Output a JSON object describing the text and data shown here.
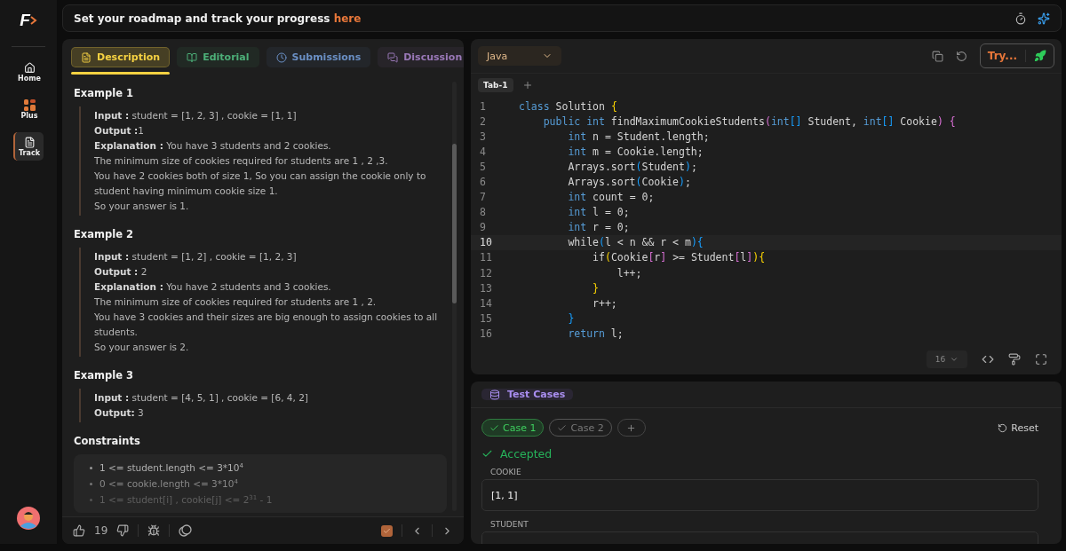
{
  "sidebar": {
    "logo": "F",
    "items": [
      {
        "label": "Home",
        "selected": false
      },
      {
        "label": "Plus",
        "selected": false
      },
      {
        "label": "Track",
        "selected": true
      }
    ]
  },
  "banner": {
    "text": "Set your roadmap and track your progress ",
    "link": "here"
  },
  "description_tabs": [
    {
      "label": "Description",
      "color": "#f5d142",
      "selected": true
    },
    {
      "label": "Editorial",
      "color": "#4caf78",
      "selected": false
    },
    {
      "label": "Submissions",
      "color": "#6a8fc4",
      "selected": false
    },
    {
      "label": "Discussion",
      "color": "#9a78b8",
      "selected": false
    }
  ],
  "examples": [
    {
      "title": "Example 1",
      "lines": [
        "**Input :** student = [1, 2, 3] , cookie = [1, 1]",
        "**Output :**1",
        "**Explanation :** You have 3 students and 2 cookies.",
        "The minimum size of cookies required for students are 1 , 2 ,3.",
        "You have 2 cookies both of size 1, So you can assign the cookie only to student having minimum cookie size 1.",
        "So your answer is 1."
      ]
    },
    {
      "title": "Example 2",
      "lines": [
        "**Input :** student = [1, 2] , cookie = [1, 2, 3]",
        "**Output :** 2",
        "**Explanation :** You have 2 students and 3 cookies.",
        "The minimum size of cookies required for students are 1 , 2.",
        "You have 3 cookies and their sizes are big enough to assign cookies to all students.",
        "So your answer is 2."
      ]
    },
    {
      "title": "Example 3",
      "lines": [
        "**Input :** student = [4, 5, 1] , cookie = [6, 4, 2]",
        "**Output:**  3"
      ]
    }
  ],
  "constraints": {
    "title": "Constraints",
    "items": [
      "1 <= student.length <= 3*10$^{4}$",
      "0 <= cookie.length <= 3*10$^{4}$",
      "1 <= student[i] , cookie[j] <= 2$^{31}$ - 1"
    ]
  },
  "footer": {
    "likes": "19",
    "solved": true
  },
  "editor": {
    "language": "Java",
    "run_label": "Try...",
    "tabs": [
      {
        "label": "Tab-1",
        "selected": true
      }
    ],
    "font_size": "16",
    "lines": [
      {
        "number": "1",
        "selected": false,
        "tokens": [
          {
            "kind": "kw",
            "text": "class"
          },
          {
            "kind": "txt",
            "text": " Solution "
          },
          {
            "kind": "b1",
            "text": "{"
          }
        ]
      },
      {
        "number": "2",
        "selected": false,
        "tokens": [
          {
            "kind": "kw",
            "text": "    public int"
          },
          {
            "kind": "txt",
            "text": " findMaximumCookieStudents"
          },
          {
            "kind": "b2",
            "text": "("
          },
          {
            "kind": "kw",
            "text": "int"
          },
          {
            "kind": "b3",
            "text": "[]"
          },
          {
            "kind": "txt",
            "text": " Student, "
          },
          {
            "kind": "kw",
            "text": "int"
          },
          {
            "kind": "b3",
            "text": "[]"
          },
          {
            "kind": "txt",
            "text": " Cookie"
          },
          {
            "kind": "b2",
            "text": ") {"
          }
        ]
      },
      {
        "number": "3",
        "selected": false,
        "tokens": [
          {
            "kind": "kw",
            "text": "        int"
          },
          {
            "kind": "txt",
            "text": " n = Student.length;"
          }
        ]
      },
      {
        "number": "4",
        "selected": false,
        "tokens": [
          {
            "kind": "kw",
            "text": "        int"
          },
          {
            "kind": "txt",
            "text": " m = Cookie.length;"
          }
        ]
      },
      {
        "number": "5",
        "selected": false,
        "tokens": [
          {
            "kind": "txt",
            "text": "        Arrays.sort"
          },
          {
            "kind": "b3",
            "text": "("
          },
          {
            "kind": "txt",
            "text": "Student"
          },
          {
            "kind": "b3",
            "text": ")"
          },
          {
            "kind": "txt",
            "text": ";"
          }
        ]
      },
      {
        "number": "6",
        "selected": false,
        "tokens": [
          {
            "kind": "txt",
            "text": "        Arrays.sort"
          },
          {
            "kind": "b3",
            "text": "("
          },
          {
            "kind": "txt",
            "text": "Cookie"
          },
          {
            "kind": "b3",
            "text": ")"
          },
          {
            "kind": "txt",
            "text": ";"
          }
        ]
      },
      {
        "number": "7",
        "selected": false,
        "tokens": [
          {
            "kind": "kw",
            "text": "        int"
          },
          {
            "kind": "txt",
            "text": " count = 0;"
          }
        ]
      },
      {
        "number": "8",
        "selected": false,
        "tokens": [
          {
            "kind": "kw",
            "text": "        int"
          },
          {
            "kind": "txt",
            "text": " l = 0;"
          }
        ]
      },
      {
        "number": "9",
        "selected": false,
        "tokens": [
          {
            "kind": "kw",
            "text": "        int"
          },
          {
            "kind": "txt",
            "text": " r = 0;"
          }
        ]
      },
      {
        "number": "10",
        "selected": true,
        "tokens": [
          {
            "kind": "txt",
            "text": "        while"
          },
          {
            "kind": "b3",
            "text": "("
          },
          {
            "kind": "txt",
            "text": "l < n && r < m"
          },
          {
            "kind": "b3",
            "text": ")"
          },
          {
            "kind": "b3",
            "text": "{"
          }
        ]
      },
      {
        "number": "11",
        "selected": false,
        "tokens": [
          {
            "kind": "txt",
            "text": "            if"
          },
          {
            "kind": "b1",
            "text": "("
          },
          {
            "kind": "txt",
            "text": "Cookie"
          },
          {
            "kind": "b2",
            "text": "["
          },
          {
            "kind": "txt",
            "text": "r"
          },
          {
            "kind": "b2",
            "text": "]"
          },
          {
            "kind": "txt",
            "text": " >= Student"
          },
          {
            "kind": "b2",
            "text": "["
          },
          {
            "kind": "txt",
            "text": "l"
          },
          {
            "kind": "b2",
            "text": "]"
          },
          {
            "kind": "b1",
            "text": ")"
          },
          {
            "kind": "b1",
            "text": "{"
          }
        ]
      },
      {
        "number": "12",
        "selected": false,
        "tokens": [
          {
            "kind": "txt",
            "text": "                l++;"
          }
        ]
      },
      {
        "number": "13",
        "selected": false,
        "tokens": [
          {
            "kind": "b1",
            "text": "            }"
          }
        ]
      },
      {
        "number": "14",
        "selected": false,
        "tokens": [
          {
            "kind": "txt",
            "text": "            r++;"
          }
        ]
      },
      {
        "number": "15",
        "selected": false,
        "tokens": [
          {
            "kind": "b3",
            "text": "        }"
          }
        ]
      },
      {
        "number": "16",
        "selected": false,
        "tokens": [
          {
            "kind": "kw",
            "text": "        return"
          },
          {
            "kind": "txt",
            "text": " l;"
          }
        ]
      }
    ]
  },
  "test_cases": {
    "title": "Test Cases",
    "cases": [
      {
        "label": "Case 1",
        "passed": true,
        "selected": true
      },
      {
        "label": "Case 2",
        "passed": true,
        "selected": false
      }
    ],
    "reset": "Reset",
    "status": "Accepted",
    "fields": [
      {
        "label": "COOKIE",
        "value": "[1, 1]"
      },
      {
        "label": "STUDENT"
      }
    ]
  }
}
